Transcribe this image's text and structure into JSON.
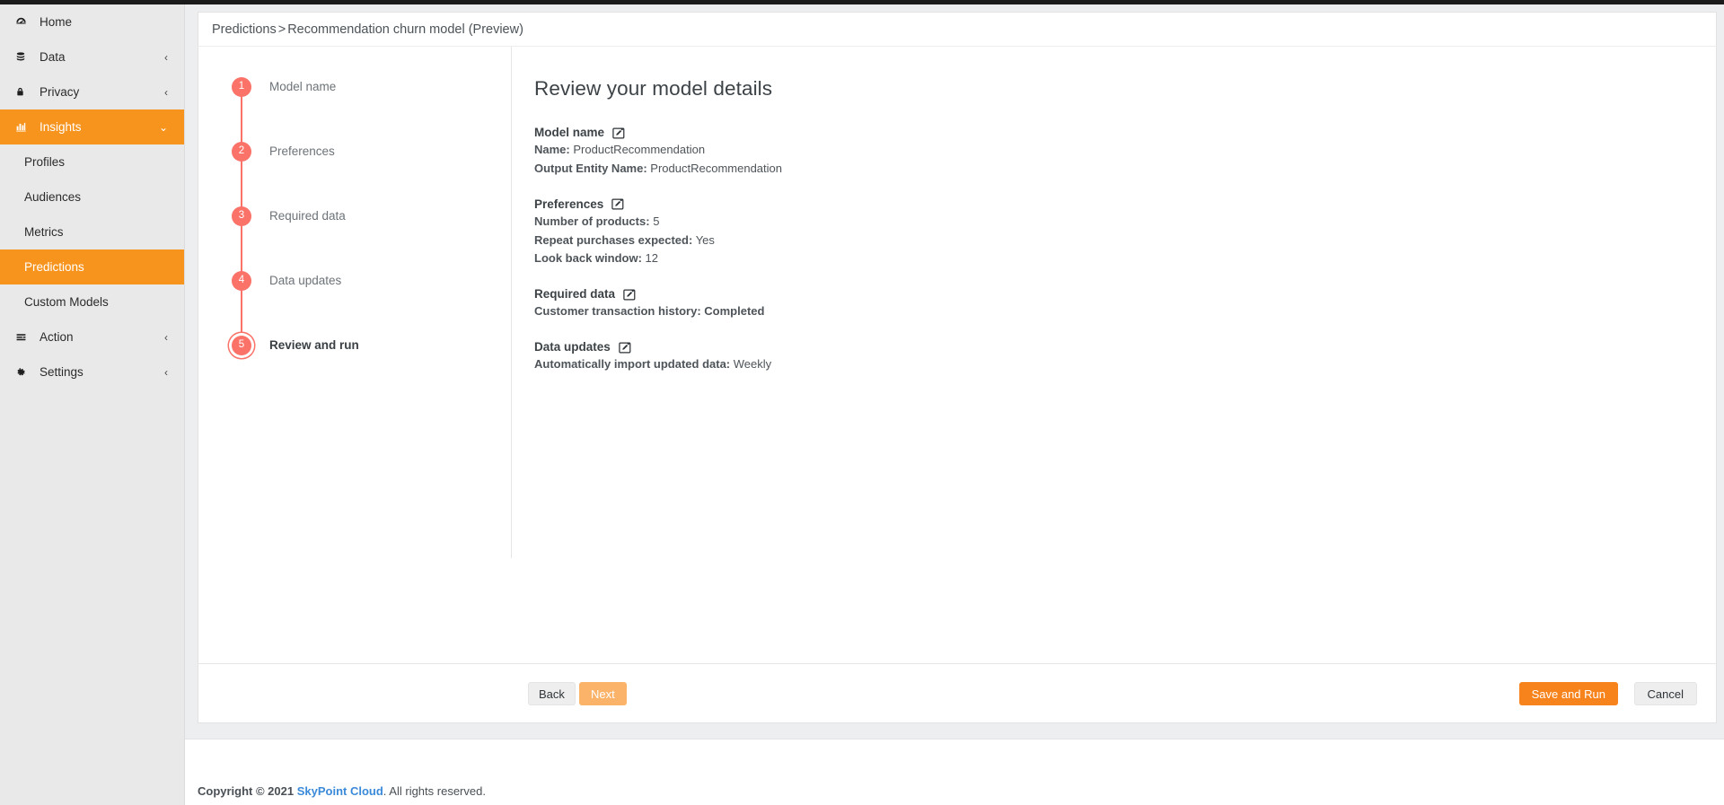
{
  "sidebar": {
    "items": [
      {
        "label": "Home",
        "icon": "dashboard-icon",
        "chevron": "",
        "active": false,
        "type": "nav"
      },
      {
        "label": "Data",
        "icon": "database-icon",
        "chevron": "‹",
        "active": false,
        "type": "nav"
      },
      {
        "label": "Privacy",
        "icon": "lock-icon",
        "chevron": "‹",
        "active": false,
        "type": "nav"
      },
      {
        "label": "Insights",
        "icon": "chart-bar-icon",
        "chevron": "⌄",
        "active": true,
        "type": "nav"
      },
      {
        "label": "Profiles",
        "icon": "",
        "chevron": "",
        "active": false,
        "type": "sub"
      },
      {
        "label": "Audiences",
        "icon": "",
        "chevron": "",
        "active": false,
        "type": "sub"
      },
      {
        "label": "Metrics",
        "icon": "",
        "chevron": "",
        "active": false,
        "type": "sub"
      },
      {
        "label": "Predictions",
        "icon": "",
        "chevron": "",
        "active": true,
        "type": "sub"
      },
      {
        "label": "Custom Models",
        "icon": "",
        "chevron": "",
        "active": false,
        "type": "sub"
      },
      {
        "label": "Action",
        "icon": "action-icon",
        "chevron": "‹",
        "active": false,
        "type": "nav"
      },
      {
        "label": "Settings",
        "icon": "gear-icon",
        "chevron": "‹",
        "active": false,
        "type": "nav"
      }
    ]
  },
  "breadcrumb": {
    "root": "Predictions",
    "separator": ">",
    "current": "Recommendation churn model (Preview)"
  },
  "stepper": {
    "steps": [
      {
        "num": "1",
        "label": "Model name",
        "current": false
      },
      {
        "num": "2",
        "label": "Preferences",
        "current": false
      },
      {
        "num": "3",
        "label": "Required data",
        "current": false
      },
      {
        "num": "4",
        "label": "Data updates",
        "current": false
      },
      {
        "num": "5",
        "label": "Review and run",
        "current": true
      }
    ]
  },
  "details": {
    "heading": "Review your model details",
    "sections": [
      {
        "title": "Model name",
        "edit_icon": "edit-pencil-icon",
        "lines": [
          {
            "key": "Name:",
            "value": "ProductRecommendation",
            "bold_value": false
          },
          {
            "key": "Output Entity Name:",
            "value": "ProductRecommendation",
            "bold_value": false
          }
        ]
      },
      {
        "title": "Preferences",
        "edit_icon": "edit-pencil-icon",
        "lines": [
          {
            "key": "Number of products:",
            "value": "5",
            "bold_value": false
          },
          {
            "key": "Repeat purchases expected:",
            "value": "Yes",
            "bold_value": false
          },
          {
            "key": "Look back window:",
            "value": "12",
            "bold_value": false
          }
        ]
      },
      {
        "title": "Required data",
        "edit_icon": "edit-pencil-icon",
        "lines": [
          {
            "key": "Customer transaction history:",
            "value": "Completed",
            "bold_value": true
          }
        ]
      },
      {
        "title": "Data updates",
        "edit_icon": "edit-pencil-icon",
        "lines": [
          {
            "key": "Automatically import updated data:",
            "value": "Weekly",
            "bold_value": false
          }
        ]
      }
    ]
  },
  "buttons": {
    "back": "Back",
    "next": "Next",
    "save_and_run": "Save and Run",
    "cancel": "Cancel"
  },
  "footer": {
    "copyright_prefix": "Copyright © 2021",
    "brand": "SkyPoint Cloud",
    "copyright_suffix": ". All rights reserved."
  },
  "colors": {
    "accent_orange": "#f7941d",
    "button_orange": "#f7831c",
    "step_coral": "#fa7268",
    "brand_link": "#3b8ad9",
    "sidebar_bg": "#e9e9e9",
    "page_bg": "#eceef0"
  }
}
